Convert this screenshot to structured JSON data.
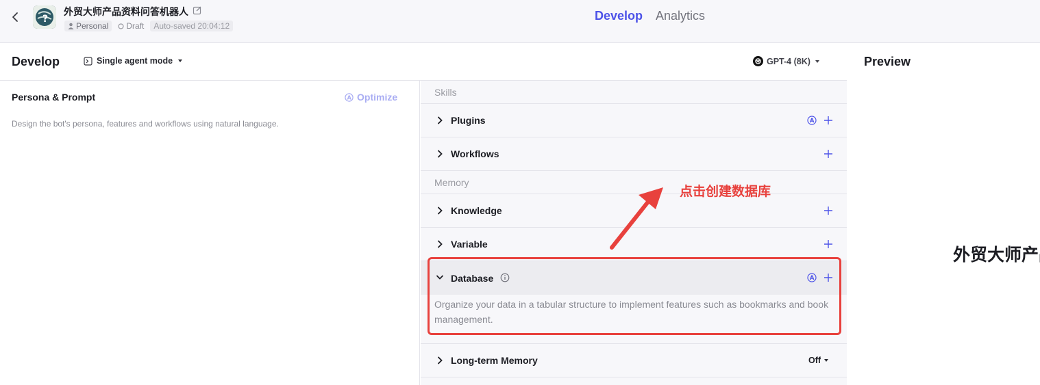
{
  "header": {
    "bot_name": "外贸大师产品资料问答机器人",
    "tag_personal": "Personal",
    "tag_draft": "Draft",
    "tag_saved": "Auto-saved 20:04:12",
    "nav_develop": "Develop",
    "nav_analytics": "Analytics"
  },
  "develop": {
    "title": "Develop",
    "mode": "Single agent mode",
    "model": "GPT-4 (8K)"
  },
  "persona": {
    "title": "Persona & Prompt",
    "optimize": "Optimize",
    "placeholder": "Design the bot's persona, features and workflows using natural language."
  },
  "skills": {
    "section_label": "Skills",
    "plugins": "Plugins",
    "workflows": "Workflows"
  },
  "memory": {
    "section_label": "Memory",
    "knowledge": "Knowledge",
    "variable": "Variable",
    "database": "Database",
    "database_desc": "Organize your data in a tabular structure to implement features such as bookmarks and book management.",
    "long_term_memory": "Long-term Memory",
    "long_term_value": "Off"
  },
  "preview": {
    "title": "Preview",
    "bot_name": "外贸大师产品资料问答机器人"
  },
  "annotation": {
    "text": "点击创建数据库"
  },
  "colors": {
    "accent": "#4d53e8",
    "annotation": "#e8413d"
  }
}
